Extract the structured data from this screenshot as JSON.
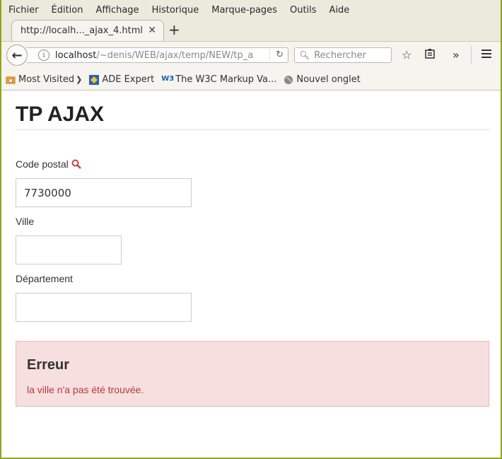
{
  "menu": [
    "Fichier",
    "Édition",
    "Affichage",
    "Historique",
    "Marque-pages",
    "Outils",
    "Aide"
  ],
  "tab": {
    "title": "http://localh..._ajax_4.html"
  },
  "navbar": {
    "url_host": "localhost",
    "url_path": "/~denis/WEB/ajax/temp/NEW/tp_a",
    "search_placeholder": "Rechercher"
  },
  "bookmarks": [
    "Most Visited",
    "ADE Expert",
    "The W3C Markup Va...",
    "Nouvel onglet"
  ],
  "page": {
    "title": "TP AJAX",
    "code_postal_label": "Code postal",
    "code_postal_value": "7730000",
    "ville_label": "Ville",
    "ville_value": "",
    "departement_label": "Département",
    "departement_value": "",
    "error_title": "Erreur",
    "error_message": "la ville n'a pas été trouvée."
  },
  "colors": {
    "accent_error": "#b3393b",
    "alert_bg": "#f8dfdf",
    "frame_border": "#8fa61b"
  }
}
